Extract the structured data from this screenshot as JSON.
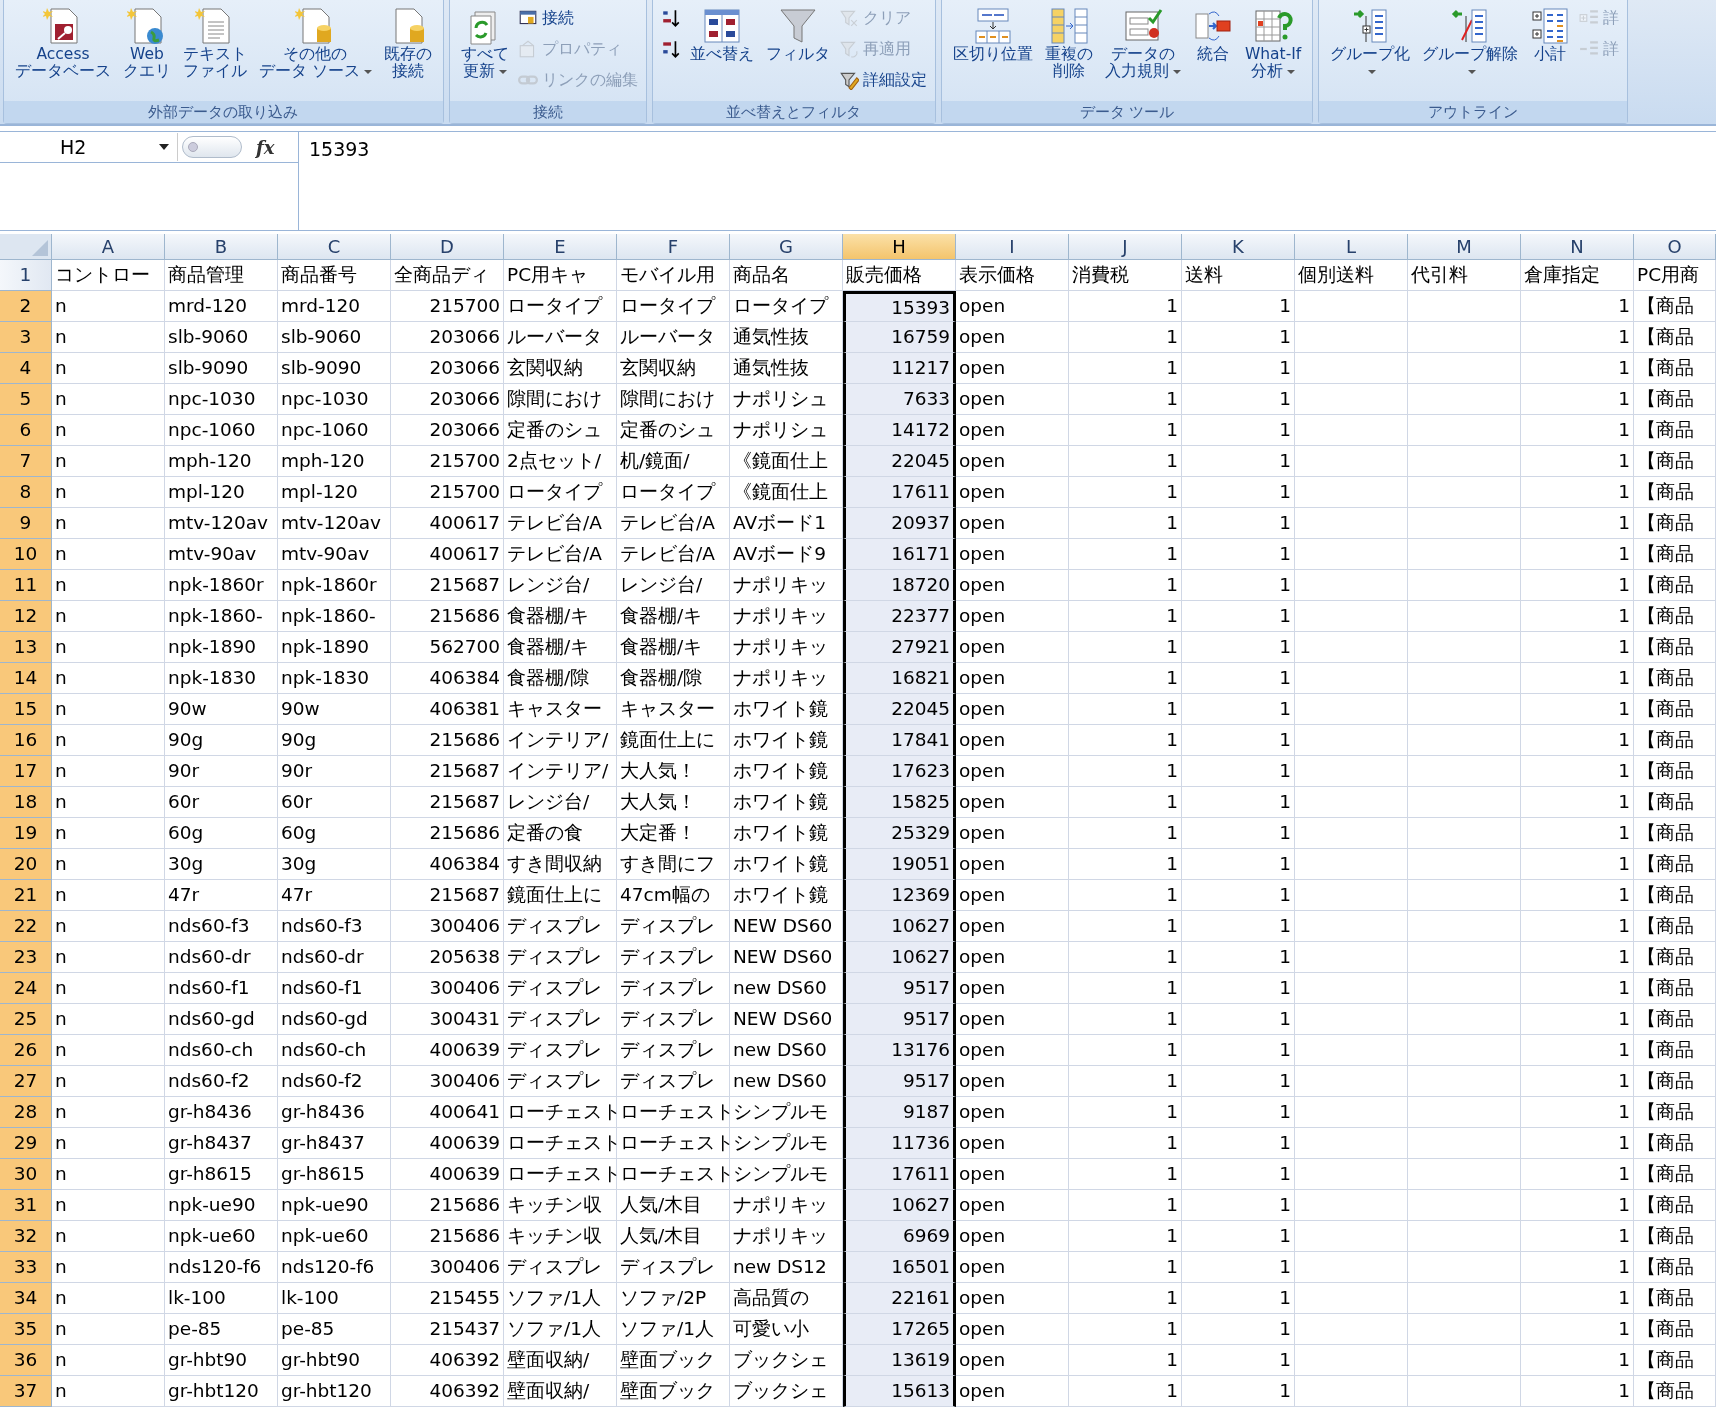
{
  "ribbon": {
    "groups": [
      {
        "label": "外部データの取り込み",
        "items": [
          {
            "kind": "large",
            "lines": [
              "Access",
              "データベース"
            ],
            "disabled": false,
            "dropdown": false
          },
          {
            "kind": "large",
            "lines": [
              "Web",
              "クエリ"
            ],
            "disabled": false,
            "dropdown": false
          },
          {
            "kind": "large",
            "lines": [
              "テキスト",
              "ファイル"
            ],
            "disabled": false,
            "dropdown": false
          },
          {
            "kind": "large",
            "lines": [
              "その他の",
              "データ ソース"
            ],
            "disabled": false,
            "dropdown": true
          },
          {
            "kind": "large",
            "lines": [
              "既存の",
              "接続"
            ],
            "disabled": false,
            "dropdown": false
          }
        ]
      },
      {
        "label": "接続",
        "items": [
          {
            "kind": "large",
            "lines": [
              "すべて",
              "更新"
            ],
            "disabled": false,
            "dropdown": true
          },
          {
            "kind": "small",
            "lines": [
              "接続"
            ],
            "disabled": false,
            "dropdown": false
          },
          {
            "kind": "small",
            "lines": [
              "プロパティ"
            ],
            "disabled": true,
            "dropdown": false
          },
          {
            "kind": "small",
            "lines": [
              "リンクの編集"
            ],
            "disabled": true,
            "dropdown": false
          }
        ]
      },
      {
        "label": "並べ替えとフィルタ",
        "items": [
          {
            "kind": "icon",
            "disabled": false,
            "dropdown": false
          },
          {
            "kind": "icon",
            "disabled": false,
            "dropdown": false
          },
          {
            "kind": "large",
            "lines": [
              "並べ替え"
            ],
            "disabled": false,
            "dropdown": false
          },
          {
            "kind": "large",
            "lines": [
              "フィルタ"
            ],
            "disabled": false,
            "dropdown": false
          },
          {
            "kind": "small",
            "lines": [
              "クリア"
            ],
            "disabled": true,
            "dropdown": false
          },
          {
            "kind": "small",
            "lines": [
              "再適用"
            ],
            "disabled": true,
            "dropdown": false
          },
          {
            "kind": "small",
            "lines": [
              "詳細設定"
            ],
            "disabled": false,
            "dropdown": false
          }
        ]
      },
      {
        "label": "データ ツール",
        "items": [
          {
            "kind": "large",
            "lines": [
              "区切り位置"
            ],
            "disabled": false,
            "dropdown": false
          },
          {
            "kind": "large",
            "lines": [
              "重複の",
              "削除"
            ],
            "disabled": false,
            "dropdown": false
          },
          {
            "kind": "large",
            "lines": [
              "データの",
              "入力規則"
            ],
            "disabled": false,
            "dropdown": true
          },
          {
            "kind": "large",
            "lines": [
              "統合"
            ],
            "disabled": false,
            "dropdown": false
          },
          {
            "kind": "large",
            "lines": [
              "What-If",
              "分析"
            ],
            "disabled": false,
            "dropdown": true
          }
        ]
      },
      {
        "label": "アウトライン",
        "items": [
          {
            "kind": "large",
            "lines": [
              "グループ化"
            ],
            "disabled": false,
            "dropdown": true
          },
          {
            "kind": "large",
            "lines": [
              "グループ解除"
            ],
            "disabled": false,
            "dropdown": true
          },
          {
            "kind": "large",
            "lines": [
              "小計"
            ],
            "disabled": false,
            "dropdown": false
          },
          {
            "kind": "small",
            "lines": [
              "詳"
            ],
            "disabled": true,
            "dropdown": false
          },
          {
            "kind": "small",
            "lines": [
              "詳"
            ],
            "disabled": true,
            "dropdown": false
          }
        ]
      }
    ]
  },
  "formula_bar": {
    "name_box": "H2",
    "function_symbol": "fx",
    "value": "15393"
  },
  "sheet": {
    "columns": [
      {
        "label": "A",
        "selected": false
      },
      {
        "label": "B",
        "selected": false
      },
      {
        "label": "C",
        "selected": false
      },
      {
        "label": "D",
        "selected": false
      },
      {
        "label": "E",
        "selected": false
      },
      {
        "label": "F",
        "selected": false
      },
      {
        "label": "G",
        "selected": false
      },
      {
        "label": "H",
        "selected": true
      },
      {
        "label": "I",
        "selected": false
      },
      {
        "label": "J",
        "selected": false
      },
      {
        "label": "K",
        "selected": false
      },
      {
        "label": "L",
        "selected": false
      },
      {
        "label": "M",
        "selected": false
      },
      {
        "label": "N",
        "selected": false
      },
      {
        "label": "O",
        "selected": false
      }
    ],
    "rows": [
      {
        "label": "1",
        "selected": false,
        "cells": [
          "コントロー",
          "商品管理",
          "商品番号",
          "全商品ディ",
          "PC用キャ",
          "モバイル用",
          "商品名",
          "販売価格",
          "表示価格",
          "消費税",
          "送料",
          "個別送料",
          "代引料",
          "倉庫指定",
          "PC用商"
        ]
      },
      {
        "label": "2",
        "selected": true,
        "cells": [
          "n",
          "mrd-120",
          "mrd-120",
          "215700",
          "ロータイプ",
          "ロータイプ",
          "ロータイプ",
          "15393",
          "open",
          "1",
          "1",
          null,
          null,
          "1",
          "【商品"
        ]
      },
      {
        "label": "3",
        "selected": true,
        "cells": [
          "n",
          "slb-9060",
          "slb-9060",
          "203066",
          "ルーバータ",
          "ルーバータ",
          "通気性抜",
          "16759",
          "open",
          "1",
          "1",
          null,
          null,
          "1",
          "【商品"
        ]
      },
      {
        "label": "4",
        "selected": true,
        "cells": [
          "n",
          "slb-9090",
          "slb-9090",
          "203066",
          "玄関収納",
          "玄関収納",
          "通気性抜",
          "11217",
          "open",
          "1",
          "1",
          null,
          null,
          "1",
          "【商品"
        ]
      },
      {
        "label": "5",
        "selected": true,
        "cells": [
          "n",
          "npc-1030",
          "npc-1030",
          "203066",
          "隙間におけ",
          "隙間におけ",
          "ナポリシュ",
          "7633",
          "open",
          "1",
          "1",
          null,
          null,
          "1",
          "【商品"
        ]
      },
      {
        "label": "6",
        "selected": true,
        "cells": [
          "n",
          "npc-1060",
          "npc-1060",
          "203066",
          "定番のシュ",
          "定番のシュ",
          "ナポリシュ",
          "14172",
          "open",
          "1",
          "1",
          null,
          null,
          "1",
          "【商品"
        ]
      },
      {
        "label": "7",
        "selected": true,
        "cells": [
          "n",
          "mph-120",
          "mph-120",
          "215700",
          "2点セット/",
          "机/鏡面/",
          "《鏡面仕上",
          "22045",
          "open",
          "1",
          "1",
          null,
          null,
          "1",
          "【商品"
        ]
      },
      {
        "label": "8",
        "selected": true,
        "cells": [
          "n",
          "mpl-120",
          "mpl-120",
          "215700",
          "ロータイプ",
          "ロータイプ",
          "《鏡面仕上",
          "17611",
          "open",
          "1",
          "1",
          null,
          null,
          "1",
          "【商品"
        ]
      },
      {
        "label": "9",
        "selected": true,
        "cells": [
          "n",
          "mtv-120av",
          "mtv-120av",
          "400617",
          "テレビ台/A",
          "テレビ台/A",
          "AVボード1",
          "20937",
          "open",
          "1",
          "1",
          null,
          null,
          "1",
          "【商品"
        ]
      },
      {
        "label": "10",
        "selected": true,
        "cells": [
          "n",
          "mtv-90av",
          "mtv-90av",
          "400617",
          "テレビ台/A",
          "テレビ台/A",
          "AVボード9",
          "16171",
          "open",
          "1",
          "1",
          null,
          null,
          "1",
          "【商品"
        ]
      },
      {
        "label": "11",
        "selected": true,
        "cells": [
          "n",
          "npk-1860r",
          "npk-1860r",
          "215687",
          "レンジ台/",
          "レンジ台/",
          "ナポリキッ",
          "18720",
          "open",
          "1",
          "1",
          null,
          null,
          "1",
          "【商品"
        ]
      },
      {
        "label": "12",
        "selected": true,
        "cells": [
          "n",
          "npk-1860-",
          "npk-1860-",
          "215686",
          "食器棚/キ",
          "食器棚/キ",
          "ナポリキッ",
          "22377",
          "open",
          "1",
          "1",
          null,
          null,
          "1",
          "【商品"
        ]
      },
      {
        "label": "13",
        "selected": true,
        "cells": [
          "n",
          "npk-1890",
          "npk-1890",
          "562700",
          "食器棚/キ",
          "食器棚/キ",
          "ナポリキッ",
          "27921",
          "open",
          "1",
          "1",
          null,
          null,
          "1",
          "【商品"
        ]
      },
      {
        "label": "14",
        "selected": true,
        "cells": [
          "n",
          "npk-1830",
          "npk-1830",
          "406384",
          "食器棚/隙",
          "食器棚/隙",
          "ナポリキッ",
          "16821",
          "open",
          "1",
          "1",
          null,
          null,
          "1",
          "【商品"
        ]
      },
      {
        "label": "15",
        "selected": true,
        "cells": [
          "n",
          "90w",
          "90w",
          "406381",
          "キャスター",
          "キャスター",
          "ホワイト鏡",
          "22045",
          "open",
          "1",
          "1",
          null,
          null,
          "1",
          "【商品"
        ]
      },
      {
        "label": "16",
        "selected": true,
        "cells": [
          "n",
          "90g",
          "90g",
          "215686",
          "インテリア/",
          "鏡面仕上に",
          "ホワイト鏡",
          "17841",
          "open",
          "1",
          "1",
          null,
          null,
          "1",
          "【商品"
        ]
      },
      {
        "label": "17",
        "selected": true,
        "cells": [
          "n",
          "90r",
          "90r",
          "215687",
          "インテリア/",
          "大人気！",
          "ホワイト鏡",
          "17623",
          "open",
          "1",
          "1",
          null,
          null,
          "1",
          "【商品"
        ]
      },
      {
        "label": "18",
        "selected": true,
        "cells": [
          "n",
          "60r",
          "60r",
          "215687",
          "レンジ台/",
          "大人気！",
          "ホワイト鏡",
          "15825",
          "open",
          "1",
          "1",
          null,
          null,
          "1",
          "【商品"
        ]
      },
      {
        "label": "19",
        "selected": true,
        "cells": [
          "n",
          "60g",
          "60g",
          "215686",
          "定番の食",
          "大定番！",
          "ホワイト鏡",
          "25329",
          "open",
          "1",
          "1",
          null,
          null,
          "1",
          "【商品"
        ]
      },
      {
        "label": "20",
        "selected": true,
        "cells": [
          "n",
          "30g",
          "30g",
          "406384",
          "すき間収納",
          "すき間にフ",
          "ホワイト鏡",
          "19051",
          "open",
          "1",
          "1",
          null,
          null,
          "1",
          "【商品"
        ]
      },
      {
        "label": "21",
        "selected": true,
        "cells": [
          "n",
          "47r",
          "47r",
          "215687",
          "鏡面仕上に",
          "47cm幅の",
          "ホワイト鏡",
          "12369",
          "open",
          "1",
          "1",
          null,
          null,
          "1",
          "【商品"
        ]
      },
      {
        "label": "22",
        "selected": true,
        "cells": [
          "n",
          "nds60-f3",
          "nds60-f3",
          "300406",
          "ディスプレ",
          "ディスプレ",
          "NEW DS60",
          "10627",
          "open",
          "1",
          "1",
          null,
          null,
          "1",
          "【商品"
        ]
      },
      {
        "label": "23",
        "selected": true,
        "cells": [
          "n",
          "nds60-dr",
          "nds60-dr",
          "205638",
          "ディスプレ",
          "ディスプレ",
          "NEW DS60",
          "10627",
          "open",
          "1",
          "1",
          null,
          null,
          "1",
          "【商品"
        ]
      },
      {
        "label": "24",
        "selected": true,
        "cells": [
          "n",
          "nds60-f1",
          "nds60-f1",
          "300406",
          "ディスプレ",
          "ディスプレ",
          "new DS60",
          "9517",
          "open",
          "1",
          "1",
          null,
          null,
          "1",
          "【商品"
        ]
      },
      {
        "label": "25",
        "selected": true,
        "cells": [
          "n",
          "nds60-gd",
          "nds60-gd",
          "300431",
          "ディスプレ",
          "ディスプレ",
          "NEW DS60",
          "9517",
          "open",
          "1",
          "1",
          null,
          null,
          "1",
          "【商品"
        ]
      },
      {
        "label": "26",
        "selected": true,
        "cells": [
          "n",
          "nds60-ch",
          "nds60-ch",
          "400639",
          "ディスプレ",
          "ディスプレ",
          "new DS60",
          "13176",
          "open",
          "1",
          "1",
          null,
          null,
          "1",
          "【商品"
        ]
      },
      {
        "label": "27",
        "selected": true,
        "cells": [
          "n",
          "nds60-f2",
          "nds60-f2",
          "300406",
          "ディスプレ",
          "ディスプレ",
          "new DS60",
          "9517",
          "open",
          "1",
          "1",
          null,
          null,
          "1",
          "【商品"
        ]
      },
      {
        "label": "28",
        "selected": true,
        "cells": [
          "n",
          "gr-h8436",
          "gr-h8436",
          "400641",
          "ローチェスト",
          "ローチェスト",
          "シンプルモ",
          "9187",
          "open",
          "1",
          "1",
          null,
          null,
          "1",
          "【商品"
        ]
      },
      {
        "label": "29",
        "selected": true,
        "cells": [
          "n",
          "gr-h8437",
          "gr-h8437",
          "400639",
          "ローチェスト",
          "ローチェスト",
          "シンプルモ",
          "11736",
          "open",
          "1",
          "1",
          null,
          null,
          "1",
          "【商品"
        ]
      },
      {
        "label": "30",
        "selected": true,
        "cells": [
          "n",
          "gr-h8615",
          "gr-h8615",
          "400639",
          "ローチェスト",
          "ローチェスト",
          "シンプルモ",
          "17611",
          "open",
          "1",
          "1",
          null,
          null,
          "1",
          "【商品"
        ]
      },
      {
        "label": "31",
        "selected": true,
        "cells": [
          "n",
          "npk-ue90",
          "npk-ue90",
          "215686",
          "キッチン収",
          "人気/木目",
          "ナポリキッ",
          "10627",
          "open",
          "1",
          "1",
          null,
          null,
          "1",
          "【商品"
        ]
      },
      {
        "label": "32",
        "selected": true,
        "cells": [
          "n",
          "npk-ue60",
          "npk-ue60",
          "215686",
          "キッチン収",
          "人気/木目",
          "ナポリキッ",
          "6969",
          "open",
          "1",
          "1",
          null,
          null,
          "1",
          "【商品"
        ]
      },
      {
        "label": "33",
        "selected": true,
        "cells": [
          "n",
          "nds120-f6",
          "nds120-f6",
          "300406",
          "ディスプレ",
          "ディスプレ",
          "new DS12",
          "16501",
          "open",
          "1",
          "1",
          null,
          null,
          "1",
          "【商品"
        ]
      },
      {
        "label": "34",
        "selected": true,
        "cells": [
          "n",
          "lk-100",
          "lk-100",
          "215455",
          "ソファ/1人",
          "ソファ/2P",
          "高品質の",
          "22161",
          "open",
          "1",
          "1",
          null,
          null,
          "1",
          "【商品"
        ]
      },
      {
        "label": "35",
        "selected": true,
        "cells": [
          "n",
          "pe-85",
          "pe-85",
          "215437",
          "ソファ/1人",
          "ソファ/1人",
          "可愛い小",
          "17265",
          "open",
          "1",
          "1",
          null,
          null,
          "1",
          "【商品"
        ]
      },
      {
        "label": "36",
        "selected": true,
        "cells": [
          "n",
          "gr-hbt90",
          "gr-hbt90",
          "406392",
          "壁面収納/",
          "壁面ブック",
          "ブックシェ",
          "13619",
          "open",
          "1",
          "1",
          null,
          null,
          "1",
          "【商品"
        ]
      },
      {
        "label": "37",
        "selected": true,
        "cells": [
          "n",
          "gr-hbt120",
          "gr-hbt120",
          "406392",
          "壁面収納/",
          "壁面ブック",
          "ブックシェ",
          "15613",
          "open",
          "1",
          "1",
          null,
          null,
          "1",
          "【商品"
        ]
      }
    ]
  }
}
